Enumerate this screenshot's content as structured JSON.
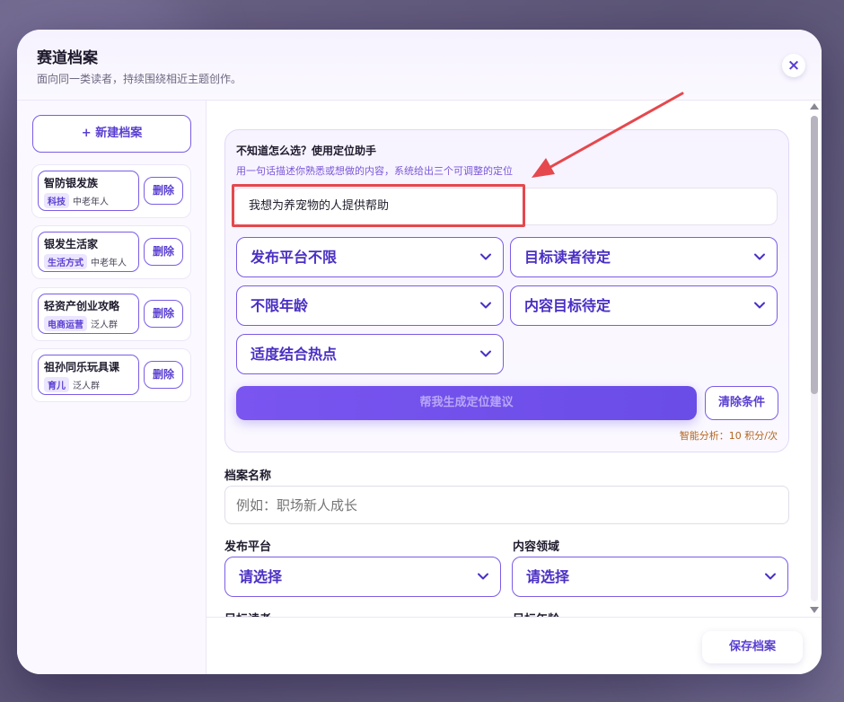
{
  "header": {
    "title": "赛道档案",
    "subtitle": "面向同一类读者，持续围绕相近主题创作。",
    "close_label": "×"
  },
  "sidebar": {
    "new_label": "+  新建档案",
    "delete_label": "删除",
    "items": [
      {
        "name": "智防银发族",
        "tag": "科技",
        "audience": "中老年人"
      },
      {
        "name": "银发生活家",
        "tag": "生活方式",
        "audience": "中老年人"
      },
      {
        "name": "轻资产创业攻略",
        "tag": "电商运营",
        "audience": "泛人群"
      },
      {
        "name": "祖孙同乐玩具课",
        "tag": "育儿",
        "audience": "泛人群"
      }
    ]
  },
  "assistant": {
    "title": "不知道怎么选？使用定位助手",
    "description": "用一句话描述你熟悉或想做的内容，系统给出三个可调整的定位",
    "prompt_value": "我想为养宠物的人提供帮助",
    "selects": [
      "发布平台不限",
      "目标读者待定",
      "不限年龄",
      "内容目标待定",
      "适度结合热点"
    ],
    "generate_label": "帮我生成定位建议",
    "clear_label": "清除条件",
    "cost_text": "智能分析：10 积分/次"
  },
  "form": {
    "name_label": "档案名称",
    "name_placeholder": "例如：职场新人成长",
    "platform_label": "发布平台",
    "platform_value": "请选择",
    "domain_label": "内容领域",
    "domain_value": "请选择",
    "audience_label": "目标读者",
    "age_label": "目标年龄"
  },
  "footer": {
    "save_label": "保存档案"
  },
  "colors": {
    "accent": "#6a4ce6",
    "annotation": "#e5484d",
    "cost": "#b5661f"
  }
}
